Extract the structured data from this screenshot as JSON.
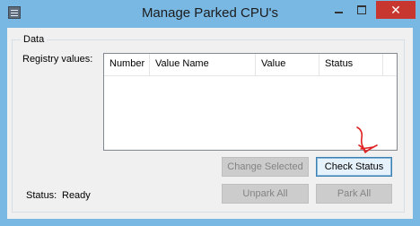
{
  "window": {
    "title": "Manage Parked CPU's",
    "close_glyph": "✕"
  },
  "group": {
    "legend": "Data",
    "registry_label": "Registry values:"
  },
  "listview": {
    "columns": [
      "Number",
      "Value Name",
      "Value",
      "Status"
    ],
    "rows": []
  },
  "buttons": {
    "change_selected": "Change Selected",
    "check_status": "Check Status",
    "unpark_all": "Unpark All",
    "park_all": "Park All"
  },
  "status": {
    "label": "Status:",
    "value": "Ready"
  },
  "colors": {
    "title_bar": "#7ab8e4",
    "close_button": "#c7372f",
    "annotation": "#e02020"
  }
}
